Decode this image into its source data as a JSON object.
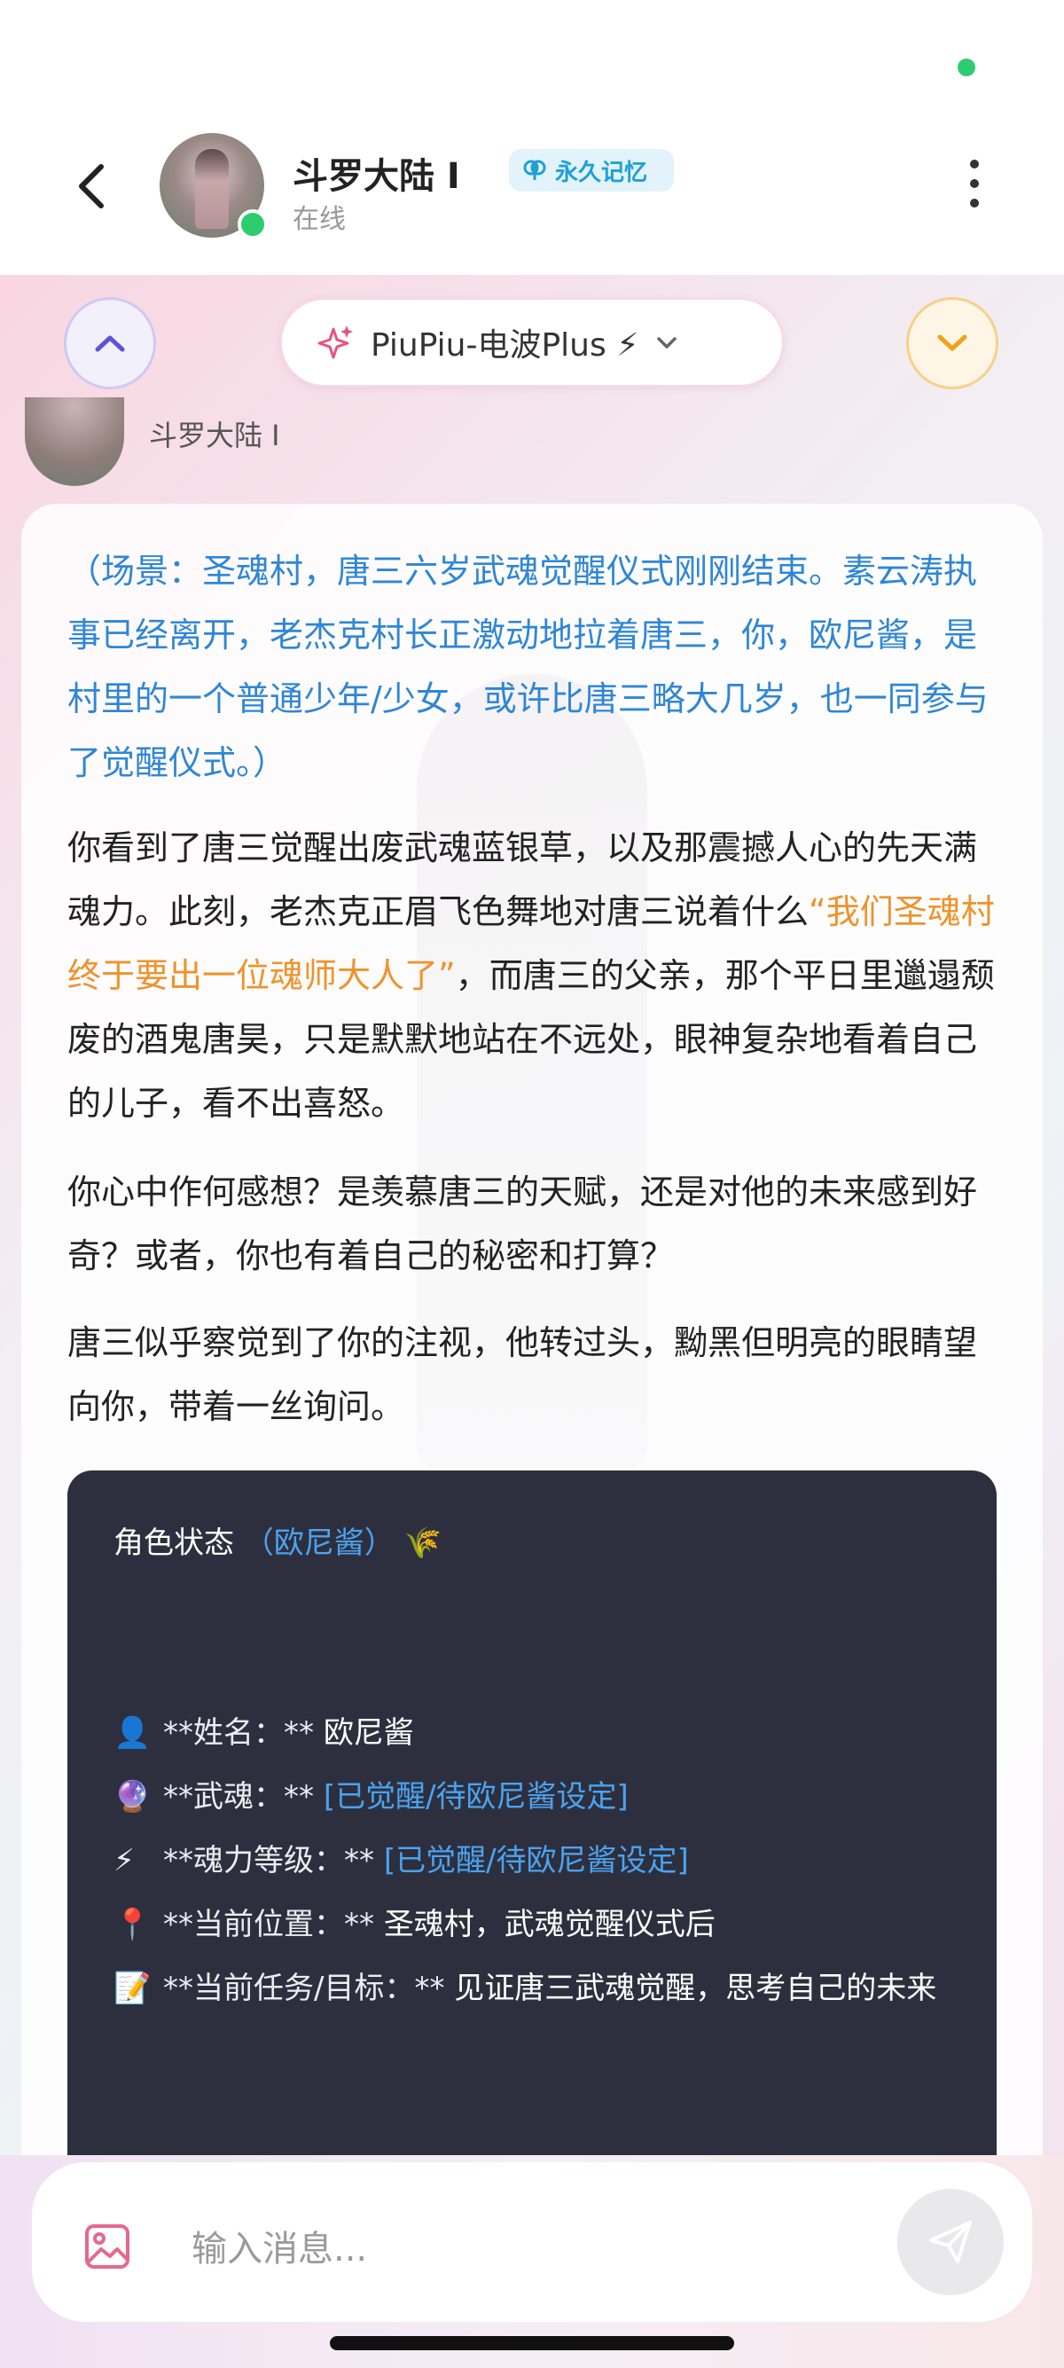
{
  "header": {
    "title": "斗罗大陆 I",
    "badge": "永久记忆",
    "status": "在线"
  },
  "toolbar": {
    "model_label": "PiuPiu-电波Plus ⚡"
  },
  "message": {
    "sender": "斗罗大陆 I",
    "scene": "（场景：圣魂村，唐三六岁武魂觉醒仪式刚刚结束。素云涛执事已经离开，老杰克村长正激动地拉着唐三，你，欧尼酱，是村里的一个普通少年/少女，或许比唐三略大几岁，也一同参与了觉醒仪式。）",
    "para1_a": "你看到了唐三觉醒出废武魂蓝银草，以及那震撼人心的先天满魂力。此刻，老杰克正眉飞色舞地对唐三说着什么",
    "para1_quote": "“我们圣魂村终于要出一位魂师大人了”",
    "para1_b": "，而唐三的父亲，那个平日里邋遢颓废的酒鬼唐昊，只是默默地站在不远处，眼神复杂地看着自己的儿子，看不出喜怒。",
    "para2": "你心中作何感想？是羡慕唐三的天赋，还是对他的未来感到好奇？或者，你也有着自己的秘密和打算？",
    "para3": "唐三似乎察觉到了你的注视，他转过头，黝黑但明亮的眼睛望向你，带着一丝询问。"
  },
  "status_card": {
    "title": "角色状态",
    "title_accent": "（欧尼酱）",
    "title_icon": "🌾",
    "rows": [
      {
        "icon": "👤",
        "label": "**姓名：**",
        "value": "欧尼酱",
        "blue": false
      },
      {
        "icon": "🔮",
        "label": "**武魂：**",
        "value": "[已觉醒/待欧尼酱设定]",
        "blue": true
      },
      {
        "icon": "⚡",
        "label": "**魂力等级：**",
        "value": "[已觉醒/待欧尼酱设定]",
        "blue": true
      },
      {
        "icon": "📍",
        "label": "**当前位置：**",
        "value": "圣魂村，武魂觉醒仪式后",
        "blue": false
      },
      {
        "icon": "📝",
        "label": "**当前任务/目标：**",
        "value": "见证唐三武魂觉醒，思考自己的未来",
        "blue": false
      }
    ]
  },
  "composer": {
    "placeholder": "输入消息..."
  },
  "colors": {
    "accent_blue": "#2f86d6",
    "quote_orange": "#f0922b",
    "online_green": "#2ecc71",
    "card_bg": "#2e2f3e"
  }
}
